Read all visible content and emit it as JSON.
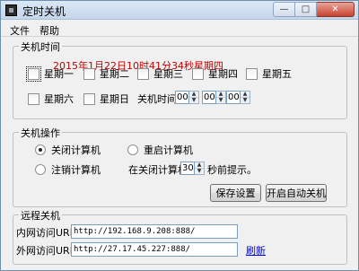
{
  "window": {
    "title": "定时关机"
  },
  "menu": {
    "file": "文件",
    "help": "帮助"
  },
  "shutdown_time": {
    "title": "关机时间",
    "current_datetime": "2015年1月22日10时41分34秒星期四",
    "weekdays": [
      {
        "label": "星期一",
        "checked": false
      },
      {
        "label": "星期二",
        "checked": false
      },
      {
        "label": "星期三",
        "checked": false
      },
      {
        "label": "星期四",
        "checked": false
      },
      {
        "label": "星期五",
        "checked": false
      },
      {
        "label": "星期六",
        "checked": false
      },
      {
        "label": "星期日",
        "checked": false
      }
    ],
    "time_label": "关机时间",
    "hour": "00",
    "minute": "00",
    "second": "00"
  },
  "shutdown_action": {
    "title": "关机操作",
    "options": [
      {
        "label": "关闭计算机",
        "checked": true
      },
      {
        "label": "重启计算机",
        "checked": false
      },
      {
        "label": "注销计算机",
        "checked": false
      }
    ],
    "prompt_prefix": "在关闭计算机",
    "prompt_seconds": "30",
    "prompt_suffix": "秒前提示。",
    "save_button": "保存设置",
    "auto_shutdown_button": "开启自动关机"
  },
  "remote": {
    "title": "远程关机",
    "lan_label": "内网访问URL:",
    "lan_url": "http://192.168.9.208:888/",
    "wan_label": "外网访问URL:",
    "wan_url": "http://27.17.45.227:888/",
    "refresh_link": "刷新"
  }
}
